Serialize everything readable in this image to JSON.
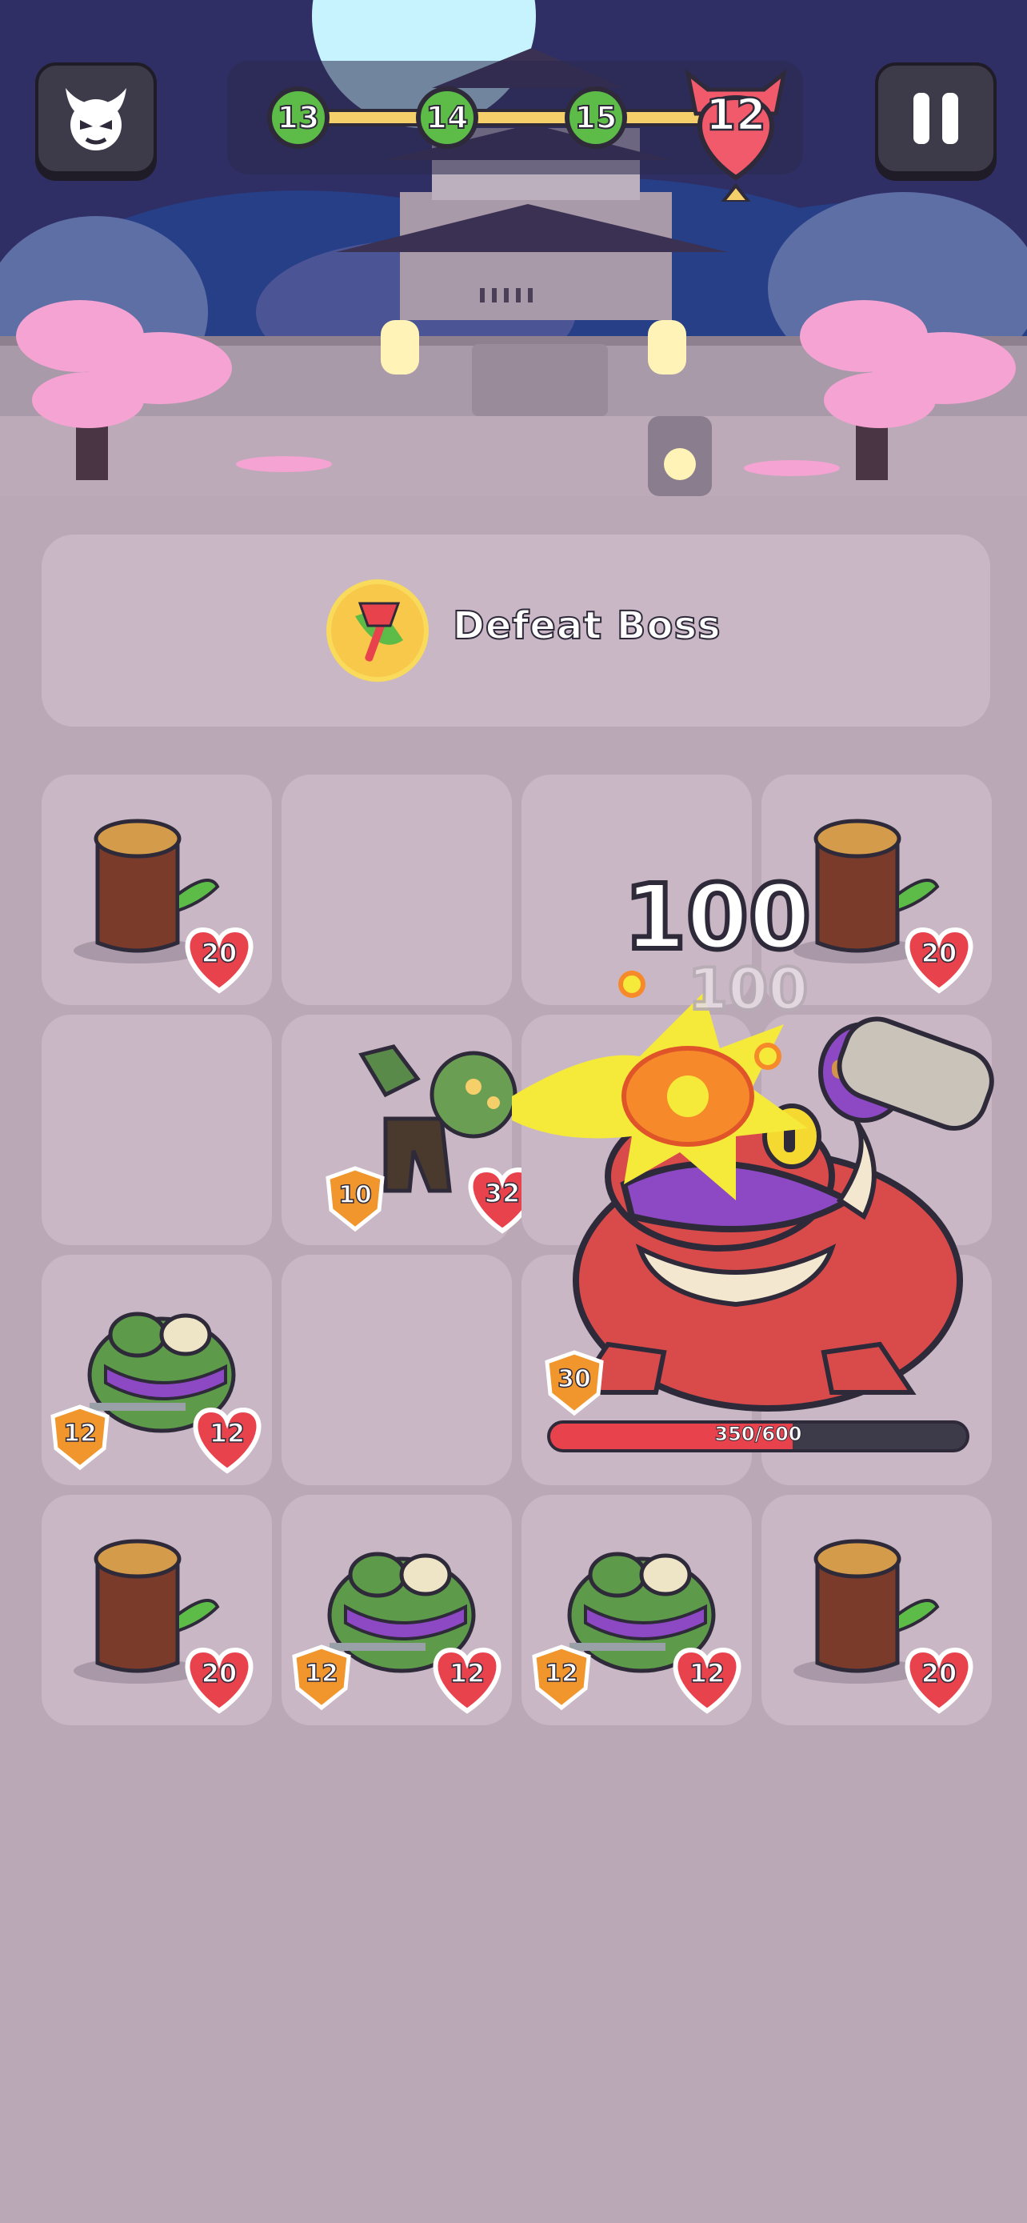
{
  "header": {
    "profile_icon": "devil-face-icon",
    "pause_icon": "pause-icon",
    "stages": [
      "13",
      "14",
      "15"
    ],
    "boss_stage": "12"
  },
  "goal": {
    "icon": "axe-icon",
    "label": "Defeat Boss"
  },
  "board": {
    "cells": [
      {
        "type": "log",
        "hp": "20"
      },
      {
        "type": "empty"
      },
      {
        "type": "empty"
      },
      {
        "type": "log",
        "hp": "20"
      },
      {
        "type": "empty"
      },
      {
        "type": "zombie",
        "attack": "10",
        "hp": "32"
      },
      {
        "type": "frog",
        "attack": "12",
        "hp": "12"
      },
      {
        "type": "empty"
      },
      {
        "type": "log",
        "hp": "20"
      },
      {
        "type": "frog",
        "attack": "12",
        "hp": "12"
      },
      {
        "type": "frog",
        "attack": "12",
        "hp": "12"
      },
      {
        "type": "log",
        "hp": "20"
      }
    ]
  },
  "boss": {
    "name_icon": "toad-boss-icon",
    "attack": "30",
    "hp_text": "350/600",
    "hp_current": 350,
    "hp_max": 600
  },
  "effects": {
    "damage_main": "100",
    "damage_ghost": "100"
  },
  "colors": {
    "accent_green": "#5dbb47",
    "heart_red": "#e8424d",
    "shield_orange": "#f0962d",
    "cell_bg": "#c9b7c5",
    "page_bg": "#bba8b6"
  }
}
